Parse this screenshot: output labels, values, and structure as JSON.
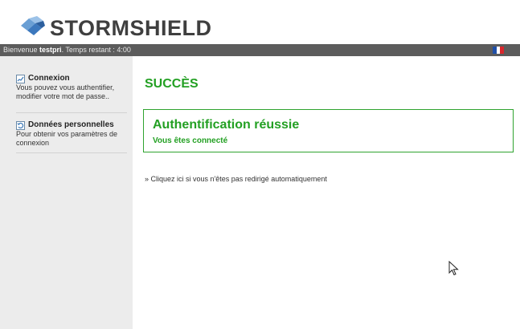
{
  "header": {
    "brand": "STORMSHIELD",
    "logo_icon": "stormshield-logo-icon"
  },
  "topbar": {
    "welcome": "Bienvenue ",
    "username": "testpri",
    "remaining": ". Temps restant : 4:00",
    "flag_icon": "french-flag-icon"
  },
  "sidebar": {
    "items": [
      {
        "icon": "chart-icon",
        "title": "Connexion",
        "description": "Vous pouvez vous authentifier, modifier votre mot de passe.."
      },
      {
        "icon": "refresh-icon",
        "title": "Données personnelles",
        "description": "Pour obtenir vos paramètres de connexion"
      }
    ]
  },
  "main": {
    "title": "SUCCÈS",
    "box": {
      "title": "Authentification réussie",
      "subtitle": "Vous êtes connecté"
    },
    "redirect_link": "» Cliquez ici si vous n'êtes pas redirigé automatiquement"
  },
  "colors": {
    "accent_green": "#23a023",
    "topbar": "#5c5c5c",
    "sidebar": "#ececec"
  }
}
